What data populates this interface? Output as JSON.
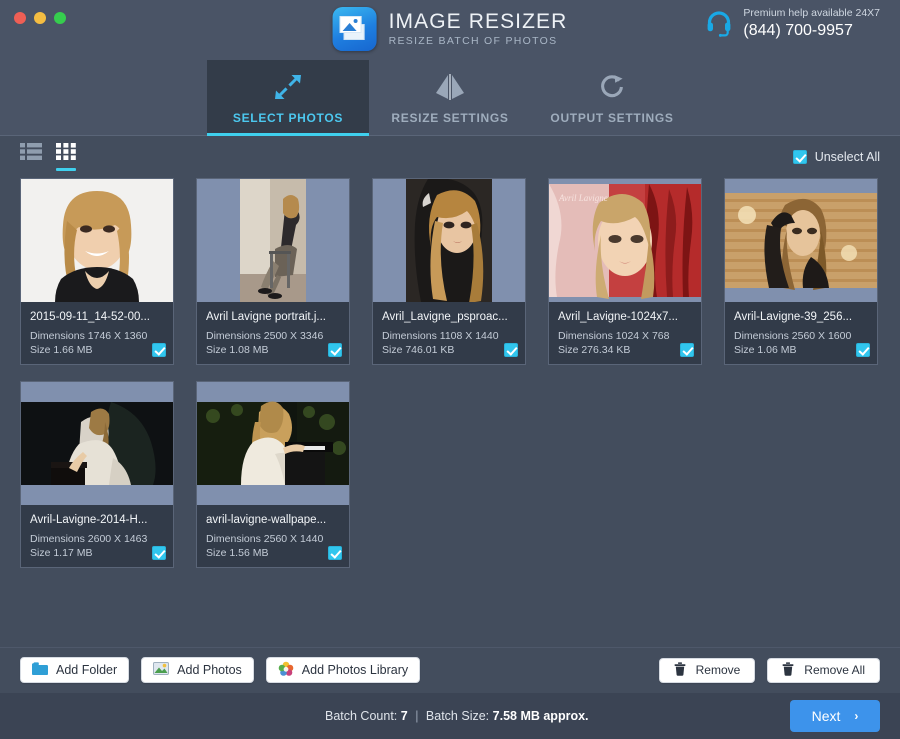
{
  "window": {
    "traffic_lights": [
      "close",
      "minimize",
      "maximize"
    ],
    "colors": {
      "accent_cyan": "#3fd0ee",
      "accent_blue": "#3d93eb",
      "header_bg": "#4a5466",
      "content_bg": "#434d5d",
      "card_meta_bg": "#323b49"
    }
  },
  "brand": {
    "title": "IMAGE RESIZER",
    "subtitle": "RESIZE BATCH OF PHOTOS",
    "icon": "image-resizer-app-icon"
  },
  "support": {
    "icon": "headset-icon",
    "line1": "Premium help available 24X7",
    "phone": "(844) 700-9957"
  },
  "tabs": [
    {
      "label": "SELECT PHOTOS",
      "icon": "resize-arrows-icon",
      "active": true
    },
    {
      "label": "RESIZE SETTINGS",
      "icon": "mirror-flip-icon",
      "active": false
    },
    {
      "label": "OUTPUT SETTINGS",
      "icon": "rotate-refresh-icon",
      "active": false
    }
  ],
  "toolbar": {
    "list_view_icon": "list-view-icon",
    "grid_view_icon": "grid-view-icon",
    "active_view": "grid",
    "unselect_all_label": "Unselect All",
    "unselect_all_checked": true
  },
  "photos": [
    {
      "name": "2015-09-11_14-52-00...",
      "dimensions": "Dimensions 1746 X 1360",
      "size": "Size 1.66 MB",
      "checked": true,
      "thumb_style": "landscape-fill-light",
      "thumb_alt": "blonde-woman-smiling-white-background"
    },
    {
      "name": "Avril Lavigne portrait.j...",
      "dimensions": "Dimensions 2500 X 3346",
      "size": "Size 1.08 MB",
      "checked": true,
      "thumb_style": "portrait-pillarbox",
      "thumb_alt": "woman-seated-on-chair-in-corridor"
    },
    {
      "name": "Avril_Lavigne_psproac...",
      "dimensions": "Dimensions 1108 X 1440",
      "size": "Size 746.01 KB",
      "checked": true,
      "thumb_style": "portrait-pillarbox",
      "thumb_alt": "woman-with-hood-dark-portrait"
    },
    {
      "name": "Avril_Lavigne-1024x7...",
      "dimensions": "Dimensions 1024 X 768",
      "size": "Size 276.34 KB",
      "checked": true,
      "thumb_style": "landscape-fill-red",
      "thumb_alt": "woman-portrait-red-hood-background"
    },
    {
      "name": "Avril-Lavigne-39_256...",
      "dimensions": "Dimensions 2560 X 1600",
      "size": "Size 1.06 MB",
      "checked": true,
      "thumb_style": "landscape-letterbox-sepia",
      "thumb_alt": "woman-against-wooden-planks-sepia"
    },
    {
      "name": "Avril-Lavigne-2014-H...",
      "dimensions": "Dimensions 2600 X 1463",
      "size": "Size 1.17 MB",
      "checked": true,
      "thumb_style": "landscape-letterbox-dark",
      "thumb_alt": "woman-in-white-dress-dark-forest"
    },
    {
      "name": "avril-lavigne-wallpape...",
      "dimensions": "Dimensions 2560 X 1440",
      "size": "Size 1.56 MB",
      "checked": true,
      "thumb_style": "landscape-letterbox-dark",
      "thumb_alt": "woman-at-piano-dark-scene"
    }
  ],
  "actions": {
    "add_folder": "Add Folder",
    "add_photos": "Add Photos",
    "add_photos_library": "Add Photos Library",
    "remove": "Remove",
    "remove_all": "Remove All"
  },
  "status": {
    "batch_count_label": "Batch Count:",
    "batch_count_value": "7",
    "separator": "|",
    "batch_size_label": "Batch Size:",
    "batch_size_value": "7.58 MB approx.",
    "next_label": "Next",
    "next_chevron": "›"
  }
}
